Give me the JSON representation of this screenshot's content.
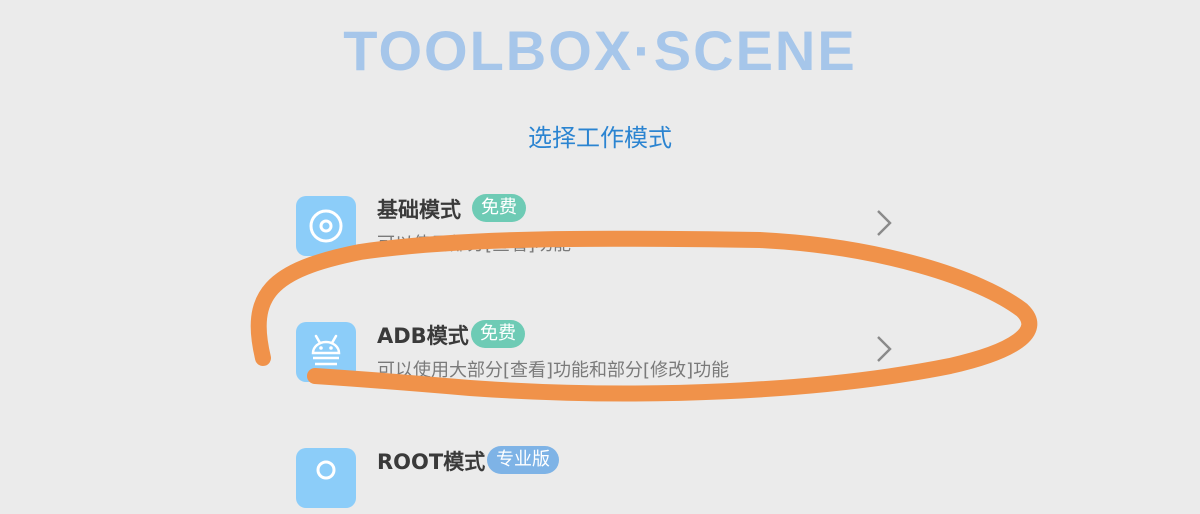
{
  "app": {
    "title": "TOOLBOX·SCENE"
  },
  "section": {
    "title": "选择工作模式"
  },
  "modes": [
    {
      "name": "基础模式",
      "badge": "免费",
      "description": "可以使用部分[查看]功能",
      "icon": "disc-icon",
      "badge_color": "#6ecbb5"
    },
    {
      "name": "ADB模式",
      "badge": "免费",
      "description": "可以使用大部分[查看]功能和部分[修改]功能",
      "icon": "android-icon",
      "badge_color": "#6ecbb5"
    },
    {
      "name": "ROOT模式",
      "badge": "专业版",
      "description": "",
      "icon": "root-icon",
      "badge_color": "#7eb3e6"
    }
  ],
  "colors": {
    "background": "#ebebeb",
    "title": "#a6c6ea",
    "accent": "#2b84d1",
    "icon_background": "#8ccdf9",
    "annotation_stroke": "#f0924a"
  }
}
